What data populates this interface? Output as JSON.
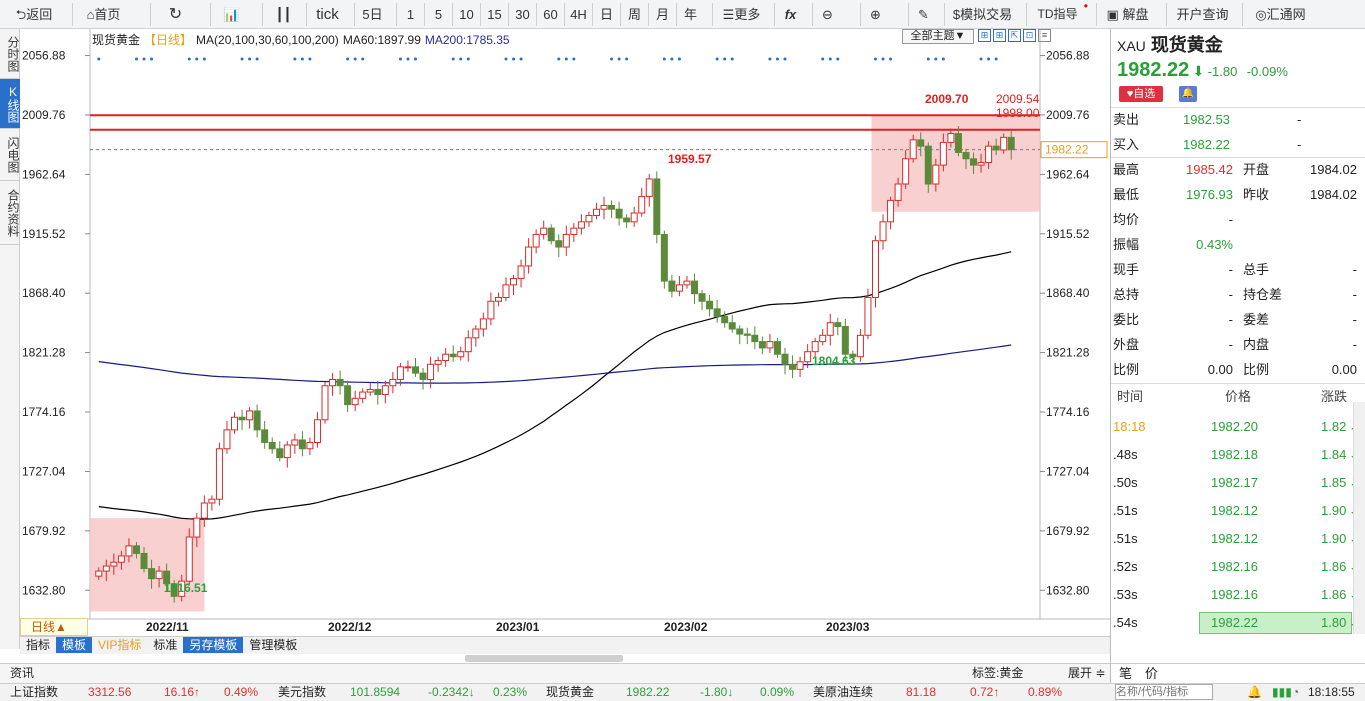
{
  "toolbar": {
    "back": "返回",
    "home": "首页",
    "refresh_icon": "refresh-icon",
    "tick": "tick",
    "periods": [
      "5日",
      "1",
      "5",
      "10",
      "15",
      "30",
      "60",
      "4H",
      "日",
      "周",
      "月",
      "年"
    ],
    "more": "更多",
    "fx": "fx",
    "sim_trade": "模拟交易",
    "td": "TD指导",
    "jiepan": "解盘",
    "open_account": "开户查询",
    "huitong": "汇通网"
  },
  "vtabs": [
    "分时图",
    "K线图",
    "闪电图",
    "合约资料"
  ],
  "legend": {
    "name": "现货黄金",
    "period": "【日线】",
    "ma": "MA(20,100,30,60,100,200)",
    "ma60": "MA60:1897.99",
    "ma200": "MA200:1785.35"
  },
  "theme_button": "全部主题▼",
  "chart_data": {
    "type": "candlestick",
    "title": "现货黄金 日线",
    "y_ticks": [
      2056.88,
      2009.76,
      1962.64,
      1915.52,
      1868.4,
      1821.28,
      1774.16,
      1727.04,
      1679.92,
      1632.8
    ],
    "x_labels": [
      "2022/11",
      "2022/12",
      "2023/01",
      "2023/02",
      "2023/03"
    ],
    "ylim": [
      1610,
      2070
    ],
    "closes": [
      1648,
      1652,
      1655,
      1660,
      1668,
      1662,
      1650,
      1642,
      1648,
      1638,
      1628,
      1640,
      1675,
      1690,
      1702,
      1705,
      1745,
      1760,
      1770,
      1768,
      1775,
      1760,
      1750,
      1745,
      1738,
      1748,
      1752,
      1745,
      1750,
      1768,
      1795,
      1800,
      1795,
      1780,
      1785,
      1790,
      1792,
      1788,
      1795,
      1800,
      1810,
      1810,
      1805,
      1800,
      1812,
      1815,
      1820,
      1818,
      1822,
      1833,
      1840,
      1848,
      1862,
      1865,
      1875,
      1880,
      1890,
      1905,
      1915,
      1920,
      1910,
      1905,
      1915,
      1920,
      1925,
      1930,
      1935,
      1938,
      1935,
      1928,
      1925,
      1932,
      1945,
      1959,
      1915,
      1878,
      1870,
      1875,
      1878,
      1868,
      1862,
      1856,
      1850,
      1845,
      1840,
      1836,
      1835,
      1830,
      1825,
      1830,
      1820,
      1812,
      1808,
      1814,
      1822,
      1830,
      1835,
      1845,
      1842,
      1820,
      1818,
      1835,
      1865,
      1910,
      1925,
      1942,
      1955,
      1975,
      1990,
      1985,
      1955,
      1970,
      1988,
      1995,
      1980,
      1975,
      1970,
      1972,
      1985,
      1982,
      1992,
      1982.22
    ],
    "annotations": [
      {
        "label": "2009.70"
      },
      {
        "label": "2009.54"
      },
      {
        "label": "1998.00"
      },
      {
        "label": "1959.57"
      },
      {
        "label": "1804.63"
      },
      {
        "label": "1616.51"
      }
    ],
    "horizontal_lines": [
      2009.54,
      1998.0
    ],
    "current_price_label": "1982.22",
    "ma_lines": [
      {
        "name": "MA60",
        "value": 1897.99,
        "color": "#000000"
      },
      {
        "name": "MA200",
        "value": 1785.35,
        "color": "#1a1a80"
      }
    ],
    "colors": {
      "up": "#d62b2b",
      "down": "#5a8a3a",
      "zone": "#f7c4c4"
    }
  },
  "kline_label": "日线▲",
  "bottom_tabs": [
    "指标",
    "模板",
    "VIP指标",
    "标准",
    "另存模板",
    "管理模板"
  ],
  "news": {
    "left": "资讯",
    "tag": "标签:黄金",
    "expand": "展开 ≑"
  },
  "status": [
    {
      "name": "上证指数",
      "value": "3312.56",
      "change": "16.16↑",
      "pct": "0.49%",
      "dir": "up"
    },
    {
      "name": "美元指数",
      "value": "101.8594",
      "change": "-0.2342↓",
      "pct": "0.23%",
      "dir": "down"
    },
    {
      "name": "现货黄金",
      "value": "1982.22",
      "change": "-1.80↓",
      "pct": "0.09%",
      "dir": "down"
    },
    {
      "name": "美原油连续",
      "value": "81.18",
      "change": "0.72↑",
      "pct": "0.89%",
      "dir": "up"
    }
  ],
  "status_right": {
    "search_placeholder": "名称/代码/指标",
    "time": "18:18:55"
  },
  "right": {
    "code": "XAU",
    "name": "现货黄金",
    "price": "1982.22",
    "change": "-1.80",
    "pct": "-0.09%",
    "fav": "自选",
    "sell_label": "卖出",
    "sell": "1982.53",
    "sell_vol": "-",
    "buy_label": "买入",
    "buy": "1982.22",
    "buy_vol": "-",
    "stats": [
      [
        "最高",
        "1985.42",
        "开盘",
        "1984.02"
      ],
      [
        "最低",
        "1976.93",
        "昨收",
        "1984.02"
      ],
      [
        "均价",
        "-",
        "",
        ""
      ],
      [
        "振幅",
        "0.43%",
        "",
        ""
      ],
      [
        "现手",
        "-",
        "总手",
        "-"
      ],
      [
        "总持",
        "-",
        "持仓差",
        "-"
      ],
      [
        "委比",
        "-",
        "委差",
        "-"
      ],
      [
        "外盘",
        "-",
        "内盘",
        "-"
      ],
      [
        "比例",
        "0.00",
        "比例",
        "0.00"
      ]
    ],
    "tick_headers": [
      "时间",
      "价格",
      "涨跌"
    ],
    "ticks": [
      [
        "18:18",
        "1982.20",
        "1.82"
      ],
      [
        ".48s",
        "1982.18",
        "1.84"
      ],
      [
        ".50s",
        "1982.17",
        "1.85"
      ],
      [
        ".51s",
        "1982.12",
        "1.90"
      ],
      [
        ".51s",
        "1982.12",
        "1.90"
      ],
      [
        ".52s",
        "1982.16",
        "1.86"
      ],
      [
        ".53s",
        "1982.16",
        "1.86"
      ],
      [
        ".54s",
        "1982.22",
        "1.80"
      ]
    ],
    "bottom": {
      "bi": "笔",
      "jia": "价"
    }
  }
}
